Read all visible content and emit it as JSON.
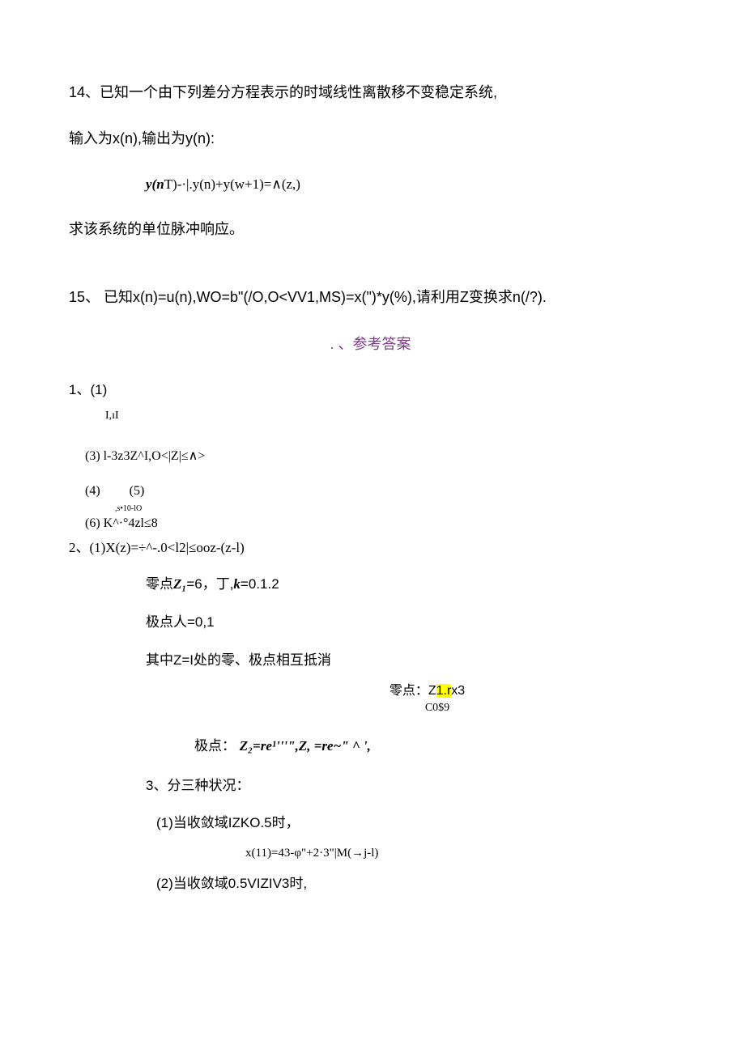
{
  "q14": {
    "line1": "14、已知一个由下列差分方程表示的时域线性离散移不变稳定系统,",
    "line2": "输入为x(n),输出为y(n):",
    "formula_pre": "y(n",
    "formula_rest": "T)-·|.y(n)+y(w+1)=∧(z,)",
    "line3": "求该系统的单位脉冲响应。"
  },
  "q15": {
    "line": "15、 已知x(n)=u(n),WO=b\"(/O,O<VV1,MS)=x(\")*y(%),请利用Z变换求n(/?)."
  },
  "answer_title": ". 、参考答案",
  "a1": {
    "hdr": "1、(1)",
    "sub111": "I,ıI",
    "i3": "(3)  l-3z3Z^I,O<|Z|≤∧>",
    "i4": "(4)",
    "i5": "(5)",
    "sub1010": ",s•10-lO",
    "i6": "(6)    K^·°4zl≤8"
  },
  "a2": {
    "line": "2、(1)X(z)=÷^-.0<l2|≤ooz-(z-l)",
    "zero_pre": "零点",
    "z1": "Z₁",
    "zero_mid": "=6，丁,",
    "k": "k",
    "zero_suf": "=0.1.2",
    "pole": "极点人=0,1",
    "cancel": "其中Z=I处的零、极点相互抵消",
    "zeroptline": "零点：Z",
    "zeropt_hl": "1.r",
    "zeropt_suf": "x3",
    "cos9": "C0$9",
    "pole2_lbl": "极点：",
    "pole2_math": "Z₂=re¹'''\",Z, =re~\" ^ ',"
  },
  "a3": {
    "hdr": "3、分三种状况：",
    "c1": "(1)当收敛域IZKO.5时，",
    "f1": "x(11)=43-φ\"+2·3\"|M(→j-l)",
    "c2": "(2)当收敛域0.5VIZIV3时,"
  }
}
